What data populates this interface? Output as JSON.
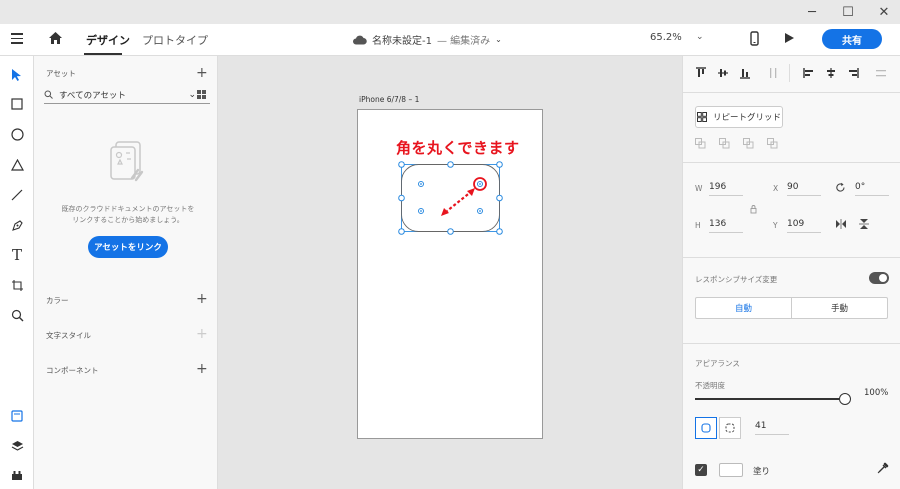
{
  "window": {
    "min": "─",
    "max": "☐",
    "close": "✕"
  },
  "header": {
    "tabs": [
      "デザイン",
      "プロトタイプ"
    ],
    "doc_title": "名称未設定-1",
    "doc_status": "— 編集済み",
    "zoom": "65.2%",
    "share": "共有"
  },
  "assets": {
    "title": "アセット",
    "filter": "すべてのアセット",
    "empty_line1": "既存のクラウドドキュメントのアセットを",
    "empty_line2": "リンクすることから始めましょう。",
    "link_button": "アセットをリンク",
    "sections": [
      "カラー",
      "文字スタイル",
      "コンポーネント"
    ]
  },
  "canvas": {
    "artboard_name": "iPhone 6/7/8 – 1",
    "callout": "角を丸くできます"
  },
  "props": {
    "repeat_grid": "リピートグリッド",
    "w_label": "W",
    "w_value": "196",
    "h_label": "H",
    "h_value": "136",
    "x_label": "X",
    "x_value": "90",
    "y_label": "Y",
    "y_value": "109",
    "rotation": "0°",
    "responsive_label": "レスポンシブサイズ変更",
    "responsive_on": true,
    "seg_auto": "自動",
    "seg_manual": "手動",
    "appearance": "アピアランス",
    "opacity_label": "不透明度",
    "opacity_value": "100%",
    "opacity_fraction": 1.0,
    "corner_radius": "41",
    "fill_label": "塗り"
  },
  "colors": {
    "accent": "#1473e6",
    "callout": "#e8141e",
    "selection": "#2b8be0"
  }
}
